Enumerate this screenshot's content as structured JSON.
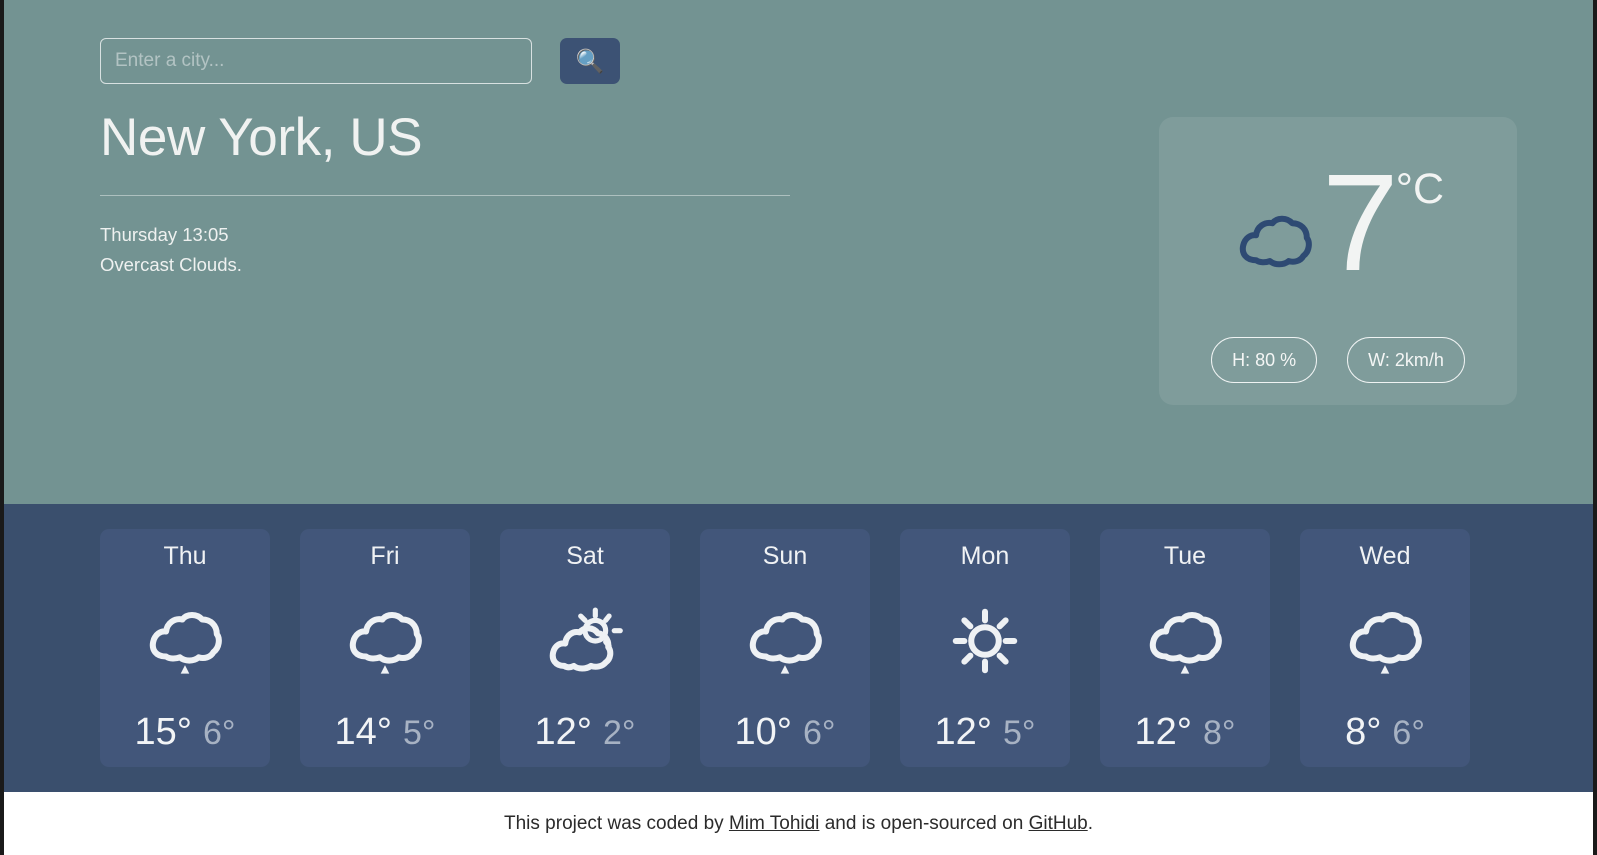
{
  "theme": {
    "hero_bg": "#739392",
    "strip_bg": "#3a4f6d",
    "card_bg": "#42567a",
    "accent_button": "#3c5274",
    "icon_dark": "#2e4a73",
    "icon_light": "#eef1f4",
    "text_light": "#f0f2f1",
    "text_dim": "#a7b2c3",
    "footer_bg": "#ffffff",
    "footer_text": "#2b2b2b"
  },
  "search": {
    "placeholder": "Enter a city...",
    "value": "",
    "button_icon": "search-icon",
    "button_glyph": "🔍"
  },
  "current": {
    "city": "New York, US",
    "datetime": "Thursday 13:05",
    "description": "Overcast Clouds.",
    "temperature": "7",
    "unit": "°C",
    "icon": "overcast-clouds-icon",
    "humidity_label": "H: 80 %",
    "wind_label": "W: 2km/h"
  },
  "forecast": {
    "days": [
      {
        "day": "Thu",
        "icon": "rain-cloud-icon",
        "high": "15°",
        "low": "6°"
      },
      {
        "day": "Fri",
        "icon": "rain-cloud-icon",
        "high": "14°",
        "low": "5°"
      },
      {
        "day": "Sat",
        "icon": "sun-cloud-icon",
        "high": "12°",
        "low": "2°"
      },
      {
        "day": "Sun",
        "icon": "rain-cloud-icon",
        "high": "10°",
        "low": "6°"
      },
      {
        "day": "Mon",
        "icon": "sun-icon",
        "high": "12°",
        "low": "5°"
      },
      {
        "day": "Tue",
        "icon": "rain-cloud-icon",
        "high": "12°",
        "low": "8°"
      },
      {
        "day": "Wed",
        "icon": "rain-cloud-icon",
        "high": "8°",
        "low": "6°"
      }
    ]
  },
  "footer": {
    "text_before": "This project was coded by ",
    "author_link": "Mim Tohidi",
    "text_middle": " and is open-sourced on ",
    "repo_link": "GitHub",
    "text_after": "."
  }
}
